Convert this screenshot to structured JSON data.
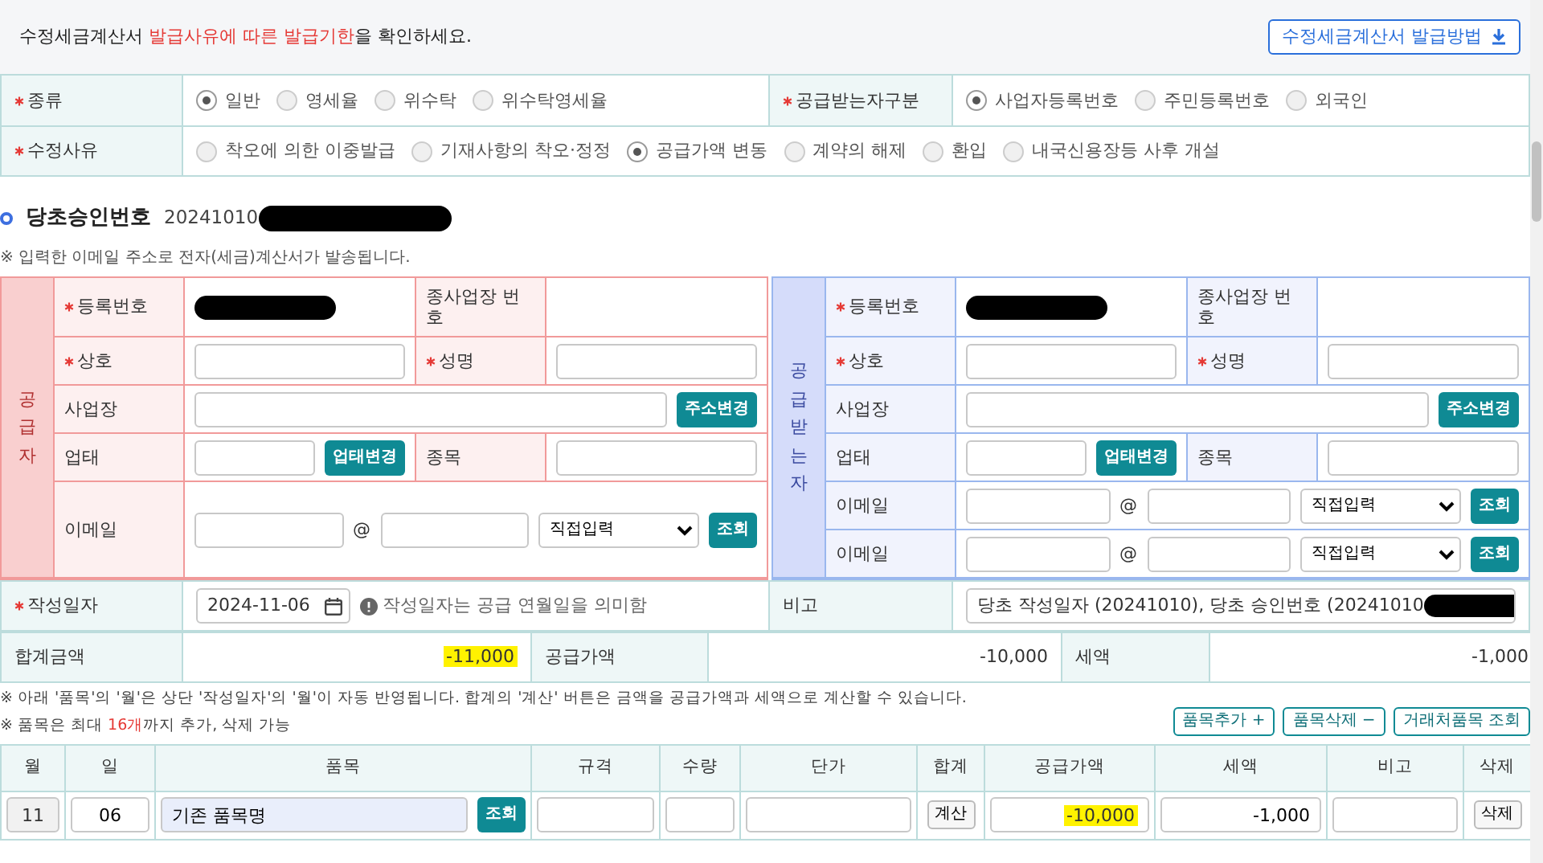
{
  "notice": {
    "text": "수정세금계산서 **발급사유에 따른 발급기한**을 확인하세요.",
    "button": "수정세금계산서 발급방법"
  },
  "type_row": {
    "label": "종류",
    "required": true,
    "options": [
      {
        "label": "일반",
        "selected": true
      },
      {
        "label": "영세율",
        "selected": false
      },
      {
        "label": "위수탁",
        "selected": false
      },
      {
        "label": "위수탁영세율",
        "selected": false
      }
    ],
    "recipient_label": "공급받는자구분",
    "recipient_required": true,
    "recipient_options": [
      {
        "label": "사업자등록번호",
        "selected": true
      },
      {
        "label": "주민등록번호",
        "selected": false
      },
      {
        "label": "외국인",
        "selected": false
      }
    ]
  },
  "reason_row": {
    "label": "수정사유",
    "required": true,
    "options": [
      {
        "label": "착오에 의한 이중발급",
        "selected": false
      },
      {
        "label": "기재사항의 착오·정정",
        "selected": false
      },
      {
        "label": "공급가액 변동",
        "selected": true
      },
      {
        "label": "계약의 해제",
        "selected": false
      },
      {
        "label": "환입",
        "selected": false
      },
      {
        "label": "내국신용장등 사후 개설",
        "selected": false
      }
    ]
  },
  "original_approval": {
    "title": "당초승인번호",
    "number": "20241010",
    "redacted": true
  },
  "email_note": "※ 입력한 이메일 주소로 전자(세금)계산서가 발송됩니다.",
  "parties": [
    {
      "kind": "supplier",
      "side_label": "공급자",
      "rows": [
        [
          {
            "kind": "label",
            "text": "등록번호",
            "required": true
          },
          {
            "kind": "redacted"
          },
          {
            "kind": "label",
            "text": "종사업장 번호",
            "required": false
          },
          {
            "kind": "blank"
          }
        ],
        [
          {
            "kind": "label",
            "text": "상호",
            "required": true
          },
          {
            "kind": "input"
          },
          {
            "kind": "label",
            "text": "성명",
            "required": true
          },
          {
            "kind": "input"
          }
        ],
        [
          {
            "kind": "label",
            "text": "사업장",
            "required": false
          },
          {
            "kind": "input_button",
            "button": "주소변경"
          }
        ],
        [
          {
            "kind": "label",
            "text": "업태",
            "required": false
          },
          {
            "kind": "input_button",
            "button": "업태변경"
          },
          {
            "kind": "label",
            "text": "종목",
            "required": false
          },
          {
            "kind": "input"
          }
        ],
        [
          {
            "kind": "label",
            "text": "이메일",
            "required": false
          },
          {
            "kind": "email",
            "at": "@",
            "select": "직접입력",
            "button": "조회"
          }
        ]
      ]
    },
    {
      "kind": "buyer",
      "side_label": "공급받는자",
      "rows": [
        [
          {
            "kind": "label",
            "text": "등록번호",
            "required": true
          },
          {
            "kind": "redacted"
          },
          {
            "kind": "label",
            "text": "종사업장 번호",
            "required": false
          },
          {
            "kind": "blank"
          }
        ],
        [
          {
            "kind": "label",
            "text": "상호",
            "required": true
          },
          {
            "kind": "input"
          },
          {
            "kind": "label",
            "text": "성명",
            "required": true
          },
          {
            "kind": "input"
          }
        ],
        [
          {
            "kind": "label",
            "text": "사업장",
            "required": false
          },
          {
            "kind": "input_button",
            "button": "주소변경"
          }
        ],
        [
          {
            "kind": "label",
            "text": "업태",
            "required": false
          },
          {
            "kind": "input_button",
            "button": "업태변경"
          },
          {
            "kind": "label",
            "text": "종목",
            "required": false
          },
          {
            "kind": "input"
          }
        ],
        [
          {
            "kind": "label",
            "text": "이메일",
            "required": false
          },
          {
            "kind": "email",
            "at": "@",
            "select": "직접입력",
            "button": "조회"
          }
        ],
        [
          {
            "kind": "label",
            "text": "이메일",
            "required": false
          },
          {
            "kind": "email",
            "at": "@",
            "select": "직접입력",
            "button": "조회"
          }
        ]
      ]
    }
  ],
  "date_row": {
    "label": "작성일자",
    "required": true,
    "date": "2024-11-06",
    "hint": "작성일자는 공급 연월일을 의미함",
    "remark_label": "비고",
    "remark": "당초 작성일자 (20241010), 당초 승인번호 (20241010",
    "remark_redacted": true
  },
  "totals": [
    {
      "label": "합계금액",
      "value": "-11,000",
      "highlighted": true
    },
    {
      "label": "공급가액",
      "value": "-10,000",
      "highlighted": false
    },
    {
      "label": "세액",
      "value": "-1,000",
      "highlighted": false
    }
  ],
  "notes": [
    "※ 아래 '품목'의 '월'은 상단 '작성일자'의 '월'이 자동 반영됩니다. 합계의 '계산' 버튼은 금액을 공급가액과 세액으로 계산할 수 있습니다.",
    "※ 품목은 최대 **16개**까지 추가, 삭제 가능"
  ],
  "item_buttons": [
    "품목추가 +",
    "품목삭제 −",
    "거래처품목 조회"
  ],
  "items": {
    "columns": [
      "월",
      "일",
      "품목",
      "규격",
      "수량",
      "단가",
      "합계",
      "공급가액",
      "세액",
      "비고",
      "삭제"
    ],
    "rows": [
      {
        "month": "11",
        "day": "06",
        "item": "기존 품목명",
        "lookup": "조회",
        "spec": "",
        "qty": "",
        "price": "",
        "calc": "계산",
        "supply": "-10,000",
        "supply_highlighted": true,
        "tax": "-1,000",
        "note": "",
        "delete": "삭제"
      }
    ]
  }
}
